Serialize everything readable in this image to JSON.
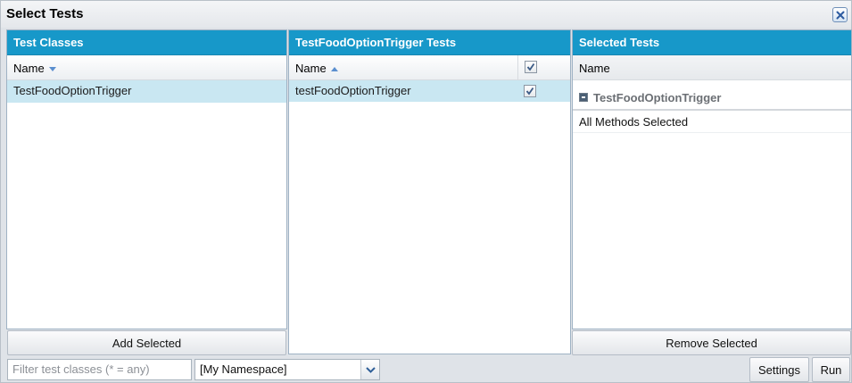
{
  "dialog": {
    "title": "Select Tests",
    "close_icon": "close-icon"
  },
  "test_classes": {
    "header": "Test Classes",
    "column_name": "Name",
    "sort": "descending",
    "rows": [
      {
        "label": "TestFoodOptionTrigger",
        "selected": true
      }
    ],
    "add_button": "Add Selected"
  },
  "class_tests": {
    "header": "TestFoodOptionTrigger Tests",
    "column_name": "Name",
    "sort": "ascending",
    "header_checked": true,
    "rows": [
      {
        "label": "testFoodOptionTrigger",
        "checked": true,
        "selected": true
      }
    ]
  },
  "selected_tests": {
    "header": "Selected Tests",
    "column_name": "Name",
    "group_label": "TestFoodOptionTrigger",
    "group_expanded": true,
    "method_label": "All Methods Selected",
    "remove_button": "Remove Selected"
  },
  "toolbar": {
    "filter_placeholder": "Filter test classes (* = any)",
    "namespace_value": "[My Namespace]",
    "settings_label": "Settings",
    "run_label": "Run"
  },
  "colors": {
    "header_blue": "#1798c9",
    "selected_row": "#c9e7f2"
  }
}
